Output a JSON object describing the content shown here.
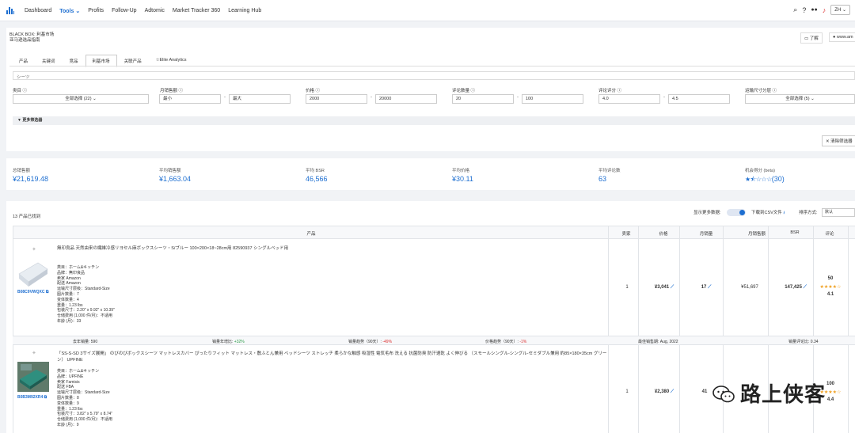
{
  "nav": {
    "items": [
      "Dashboard",
      "Tools",
      "Profits",
      "Follow-Up",
      "Adtomic",
      "Market Tracker 360",
      "Learning Hub"
    ],
    "active": "Tools",
    "lang": "ZH"
  },
  "header": {
    "title_line1": "BLACK BOX: 利基市场",
    "title_line2": "亚马逊选品指南",
    "learn": "了解",
    "url": "www.am"
  },
  "tabs": [
    "产品",
    "关键词",
    "竞品",
    "利基市场",
    "关联产品",
    "Elite Analytics"
  ],
  "active_tab": "利基市场",
  "search": {
    "value": "シーツ"
  },
  "filters": {
    "category": {
      "label": "类目 ⓘ",
      "value": "全部选择 (22)"
    },
    "monthly_sales": {
      "label": "月销售额 ⓘ",
      "min": "最小",
      "max": "最大"
    },
    "price": {
      "label": "价格 ⓘ",
      "min": "2000",
      "max": "20000"
    },
    "review_count": {
      "label": "评论数量 ⓘ",
      "min": "20",
      "max": "100"
    },
    "rating": {
      "label": "评论评分 ⓘ",
      "min": "4.0",
      "max": "4.5"
    },
    "size_tier": {
      "label": "运输尺寸分层 ⓘ",
      "value": "全部选择 (5)"
    }
  },
  "more_filters": "更多筛选器",
  "clear_filters": "清除筛选器",
  "stats": {
    "total_revenue": {
      "label": "总销售额",
      "value": "¥21,619.48"
    },
    "avg_revenue": {
      "label": "平均销售额",
      "value": "¥1,663.04"
    },
    "avg_bsr": {
      "label": "平均 BSR",
      "value": "46,566"
    },
    "avg_price": {
      "label": "平均价格",
      "value": "¥30.11"
    },
    "avg_reviews": {
      "label": "平均评论数",
      "value": "63"
    },
    "opportunity": {
      "label": "机会得分 (beta)",
      "value": "(30)",
      "stars_filled": 1.5,
      "stars_total": 5
    }
  },
  "results": {
    "count": "13 产品已找到",
    "show_more": "显示更多数据:",
    "download": "下载到CSV文件",
    "sort_label": "排序方式:",
    "sort_value": "默认"
  },
  "columns": [
    "产品",
    "卖家",
    "价格",
    "月销量",
    "月销售额",
    "BSR",
    "评论"
  ],
  "products": [
    {
      "title": "無印良品 天然由来の繊維冷感リヨセル麻ボックスシーツ・S/ブルー 100×200×18~28cm用 82590937 シングルベッド用",
      "asin": "B08C9VWQXC",
      "attrs": [
        "类目：ホーム&キッチン",
        "品牌：無印良品",
        "卖家 Amazon",
        "配送 Amazon",
        "运输尺寸层级：Standard-Size",
        "图片数量：7",
        "变体数量：4",
        "重量：1.23 lbs",
        "包装尺寸：2.20\" x 9.92\" x 10.39\"",
        "仓储费用 (1,000 件/月)：不适用",
        "年龄 (月)：33"
      ],
      "sellers": "1",
      "price": "¥3,041",
      "sales": "17",
      "revenue": "¥51,697",
      "bsr": "147,425",
      "reviews": "50",
      "rating": "4.1",
      "metrics": {
        "last_year_sales": "590",
        "yoy": "+32%",
        "sales_trend": "-49%",
        "price_trend": "-1%",
        "best_month": "Aug, 2022",
        "review_rate": "0.34"
      },
      "metric_labels": {
        "last_year_sales": "去年销量:",
        "yoy": "销量年增比:",
        "sales_trend": "销量趋势（90天）:",
        "price_trend": "价格趋势（90天）:",
        "best_month": "最佳销售期:",
        "review_rate": "销量评论比:"
      }
    },
    {
      "title": "「SS-S-SD 3サイズ展開」 のびのびボックスシーツ マットレスカバー ぴったりフィット マットレス・敷ふとん兼用 ベッドシーツ ストレッチ 柔らかな触感 吸湿性 電気毛布 洗える 抗菌防臭 防汗速乾 よく伸びる （スモールシングル-シングル-セミダブル兼用 約85×180×35cm グリーン） UPFINE",
      "asin": "B0B3M92XR4",
      "attrs": [
        "类目：ホーム&キッチン",
        "品牌：UPFINE",
        "卖家 Famisis",
        "配送 FBA",
        "运输尺寸层级：Standard-Size",
        "图片数量：8",
        "变体数量：9",
        "重量：1.23 lbs",
        "包装尺寸：3.82\" x 5.79\" x 8.74\"",
        "仓储费用 (1,000 件/月)：不适用",
        "年龄 (月)：9"
      ],
      "sellers": "1",
      "price": "¥2,380",
      "sales": "41",
      "reviews": "100",
      "rating": "4.4"
    }
  ],
  "watermark": "路上侠客",
  "colors": {
    "accent": "#1e6fd1",
    "green": "#2e9d4a",
    "red": "#dd3333",
    "star": "#f0a020"
  }
}
